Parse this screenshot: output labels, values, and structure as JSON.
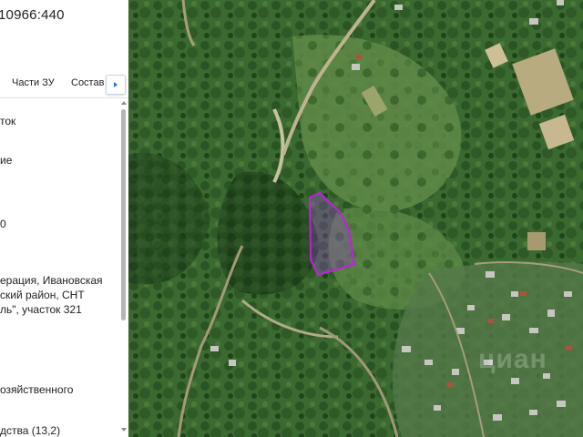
{
  "panel": {
    "cadastral_number": "10966:440",
    "tabs": [
      "Части ЗУ",
      "Состав"
    ],
    "fields": [
      "ток",
      "ие",
      "0",
      "ерация, Ивановская",
      "ский район, СНТ",
      "ль\", участок 321",
      "озяйственного",
      "дства (13,2)"
    ]
  },
  "map": {
    "watermark": "циан"
  },
  "colors": {
    "parcel_outline": "#c020e0",
    "tab_arrow": "#2a6ed8"
  }
}
